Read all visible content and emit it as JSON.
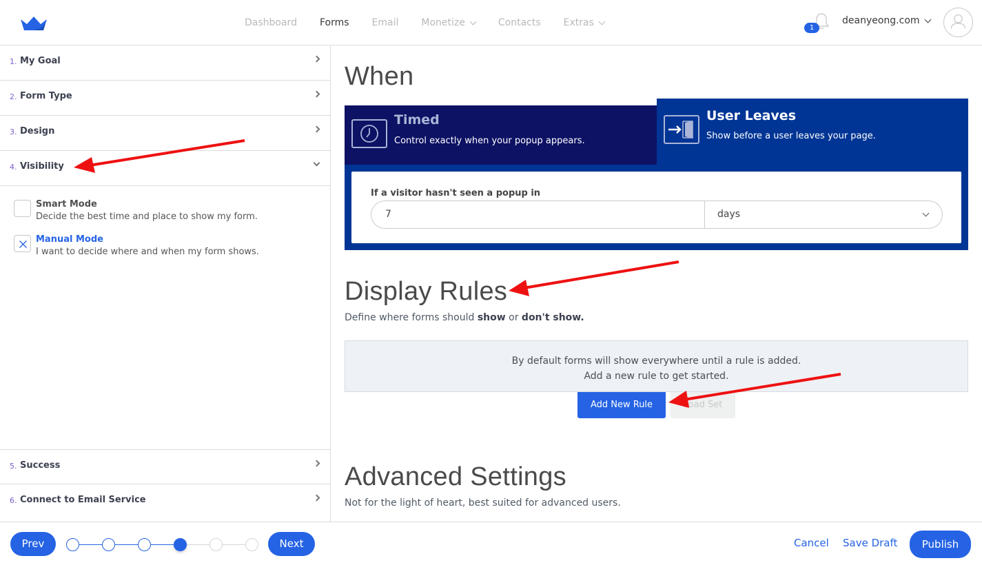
{
  "colors": {
    "accent": "#2563e4",
    "timed_bg": "#0d1264",
    "panel_bg": "#003595",
    "step_number": "#7b5fc9",
    "annotation": "#ee1111"
  },
  "nav": {
    "items": [
      {
        "label": "Dashboard",
        "active": false,
        "dropdown": false
      },
      {
        "label": "Forms",
        "active": true,
        "dropdown": false
      },
      {
        "label": "Email",
        "active": false,
        "dropdown": false
      },
      {
        "label": "Monetize",
        "active": false,
        "dropdown": true
      },
      {
        "label": "Contacts",
        "active": false,
        "dropdown": false
      },
      {
        "label": "Extras",
        "active": false,
        "dropdown": true
      }
    ],
    "notification_count": "1",
    "account": "deanyeong.com"
  },
  "sidebar": {
    "steps": [
      {
        "num": "1.",
        "label": "My Goal"
      },
      {
        "num": "2.",
        "label": "Form Type"
      },
      {
        "num": "3.",
        "label": "Design"
      },
      {
        "num": "4.",
        "label": "Visibility",
        "expanded": true
      },
      {
        "num": "5.",
        "label": "Success"
      },
      {
        "num": "6.",
        "label": "Connect to Email Service"
      }
    ],
    "modes": [
      {
        "title": "Smart Mode",
        "desc": "Decide the best time and place to show my form.",
        "checked": false
      },
      {
        "title": "Manual Mode",
        "desc": "I want to decide where and when my form shows.",
        "checked": true
      }
    ]
  },
  "main": {
    "when": {
      "heading": "When",
      "tabs": [
        {
          "title": "Timed",
          "desc": "Control exactly when your popup appears.",
          "icon": "clock-icon",
          "active": false
        },
        {
          "title": "User Leaves",
          "desc": "Show before a user leaves your page.",
          "icon": "exit-door-icon",
          "active": true
        }
      ],
      "label": "If a visitor hasn't seen a popup in",
      "value": "7",
      "unit": "days"
    },
    "display_rules": {
      "heading": "Display Rules",
      "sub_prefix": "Define where forms should ",
      "sub_show": "show",
      "sub_or": " or ",
      "sub_dont": "don't show.",
      "empty_line1": "By default forms will show everywhere until a rule is added.",
      "empty_line2": "Add a new rule to get started.",
      "add_button": "Add New Rule",
      "load_button": "Load Set"
    },
    "advanced": {
      "heading": "Advanced Settings",
      "sub": "Not for the light of heart, best suited for advanced users."
    }
  },
  "footer": {
    "prev": "Prev",
    "next": "Next",
    "progress": {
      "current_step": 4,
      "total_steps": 6
    },
    "cancel": "Cancel",
    "save_draft": "Save Draft",
    "publish": "Publish"
  }
}
